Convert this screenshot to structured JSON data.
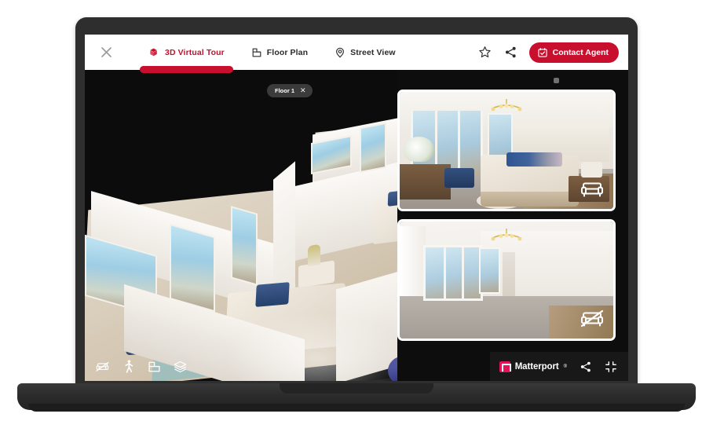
{
  "app": {
    "brand_name": "Matterport",
    "brand_tm": "®",
    "accent_color": "#C8102E",
    "brand_color": "#E2125B"
  },
  "navbar": {
    "close_label": "×",
    "tabs": [
      {
        "label": "3D Virtual Tour",
        "icon": "cube-3d-icon",
        "active": true
      },
      {
        "label": "Floor Plan",
        "icon": "floor-plan-icon",
        "active": false
      },
      {
        "label": "Street View",
        "icon": "map-pin-icon",
        "active": false
      }
    ],
    "actions": {
      "favorite_icon": "star-icon",
      "share_icon": "share-icon",
      "contact_label": "Contact Agent",
      "contact_icon": "calendar-check-icon"
    }
  },
  "viewer": {
    "floor_label": "Floor 1",
    "floor_close": "✕",
    "tools": [
      {
        "name": "hide-furniture-icon",
        "label": "Hide furniture"
      },
      {
        "name": "walkthrough-icon",
        "label": "Walkthrough"
      },
      {
        "name": "dollhouse-icon",
        "label": "Dollhouse"
      },
      {
        "name": "floors-layers-icon",
        "label": "Floors"
      }
    ],
    "footer_actions": [
      {
        "name": "share-icon",
        "label": "Share"
      },
      {
        "name": "fullscreen-exit-icon",
        "label": "Exit fullscreen"
      }
    ]
  },
  "thumbnails": [
    {
      "name": "furnished-room-thumbnail",
      "badge_icon": "furniture-on-icon",
      "alt": "Furnished bedroom with chandelier and city view"
    },
    {
      "name": "unfurnished-room-thumbnail",
      "badge_icon": "furniture-off-icon",
      "alt": "Empty room with chandelier and windows"
    }
  ]
}
